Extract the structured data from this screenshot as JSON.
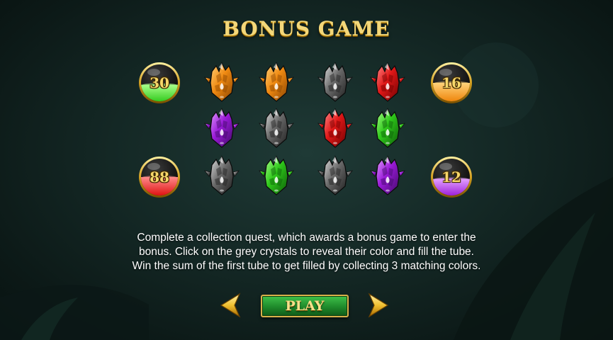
{
  "title": "BONUS GAME",
  "colors": {
    "gold": "#f3d77a",
    "orange": "#f08a12",
    "grey": "#6a6a6a",
    "red": "#e01818",
    "purple": "#9a1ad8",
    "green": "#2ec81a"
  },
  "board": {
    "rows": [
      [
        "orange",
        "orange",
        "grey",
        "red"
      ],
      [
        "purple",
        "grey",
        "red",
        "green"
      ],
      [
        "grey",
        "green",
        "grey",
        "purple"
      ]
    ]
  },
  "tubes": [
    {
      "value": "30",
      "color": "green",
      "fill": 0.45
    },
    {
      "value": "16",
      "color": "orange",
      "fill": 0.5
    },
    {
      "value": "88",
      "color": "red",
      "fill": 0.5
    },
    {
      "value": "12",
      "color": "purple",
      "fill": 0.45
    }
  ],
  "description": "Complete a collection quest, which awards a bonus game to enter the bonus. Click on the grey crystals to reveal their color and fill the tube. Win the sum of the first tube to get filled by collecting 3 matching colors.",
  "buttons": {
    "play_label": "PLAY",
    "prev_icon": "arrow-left-icon",
    "next_icon": "arrow-right-icon"
  }
}
